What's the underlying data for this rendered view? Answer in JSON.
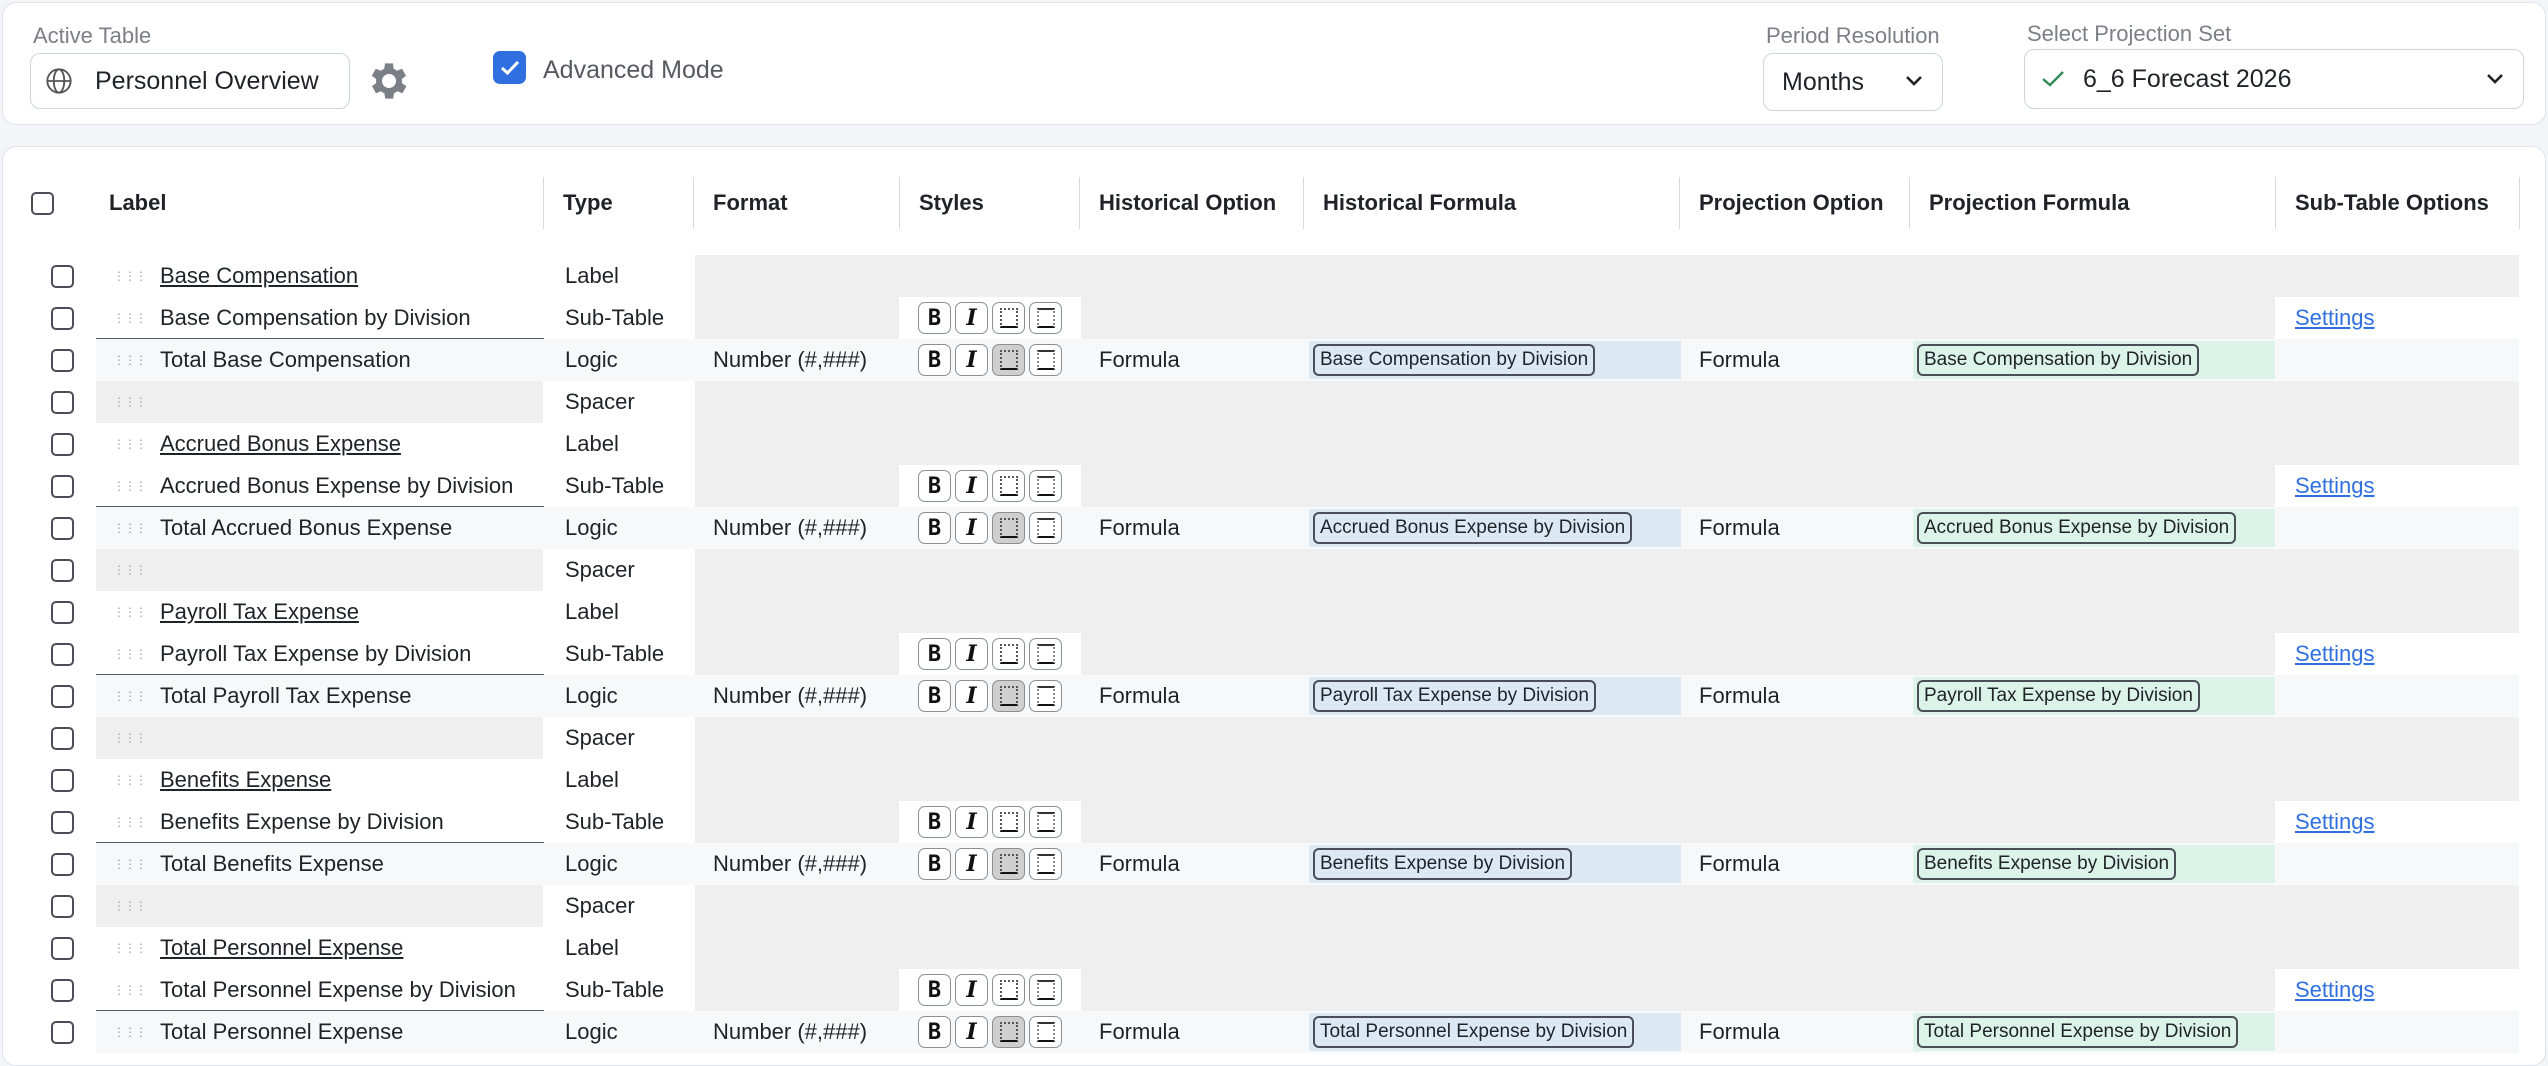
{
  "topbar": {
    "active_table_label": "Active Table",
    "active_table_value": "Personnel Overview",
    "advanced_mode_label": "Advanced Mode",
    "advanced_mode_checked": true,
    "period_label": "Period Resolution",
    "period_value": "Months",
    "projection_set_label": "Select Projection Set",
    "projection_set_value": "6_6 Forecast 2026"
  },
  "columns": {
    "label": "Label",
    "type": "Type",
    "format": "Format",
    "styles": "Styles",
    "historical_option": "Historical Option",
    "historical_formula": "Historical Formula",
    "projection_option": "Projection Option",
    "projection_formula": "Projection Formula",
    "subtable_options": "Sub-Table Options"
  },
  "colors": {
    "accent": "#2f6fe0",
    "historical_formula_bg": "#dce9f5",
    "projection_formula_bg": "#dcf3e9",
    "disabled_bg": "#efefef"
  },
  "rows": [
    {
      "label": "Base Compensation",
      "type": "Label"
    },
    {
      "label": "Base Compensation by Division",
      "type": "Sub-Table",
      "settings": "Settings"
    },
    {
      "label": "Total Base Compensation",
      "type": "Logic",
      "format": "Number (#,###)",
      "historical_option": "Formula",
      "historical_formula": "Base Compensation by Division",
      "projection_option": "Formula",
      "projection_formula": "Base Compensation by Division"
    },
    {
      "label": "",
      "type": "Spacer"
    },
    {
      "label": "Accrued Bonus Expense",
      "type": "Label"
    },
    {
      "label": "Accrued Bonus Expense by Division",
      "type": "Sub-Table",
      "settings": "Settings"
    },
    {
      "label": "Total Accrued Bonus Expense",
      "type": "Logic",
      "format": "Number (#,###)",
      "historical_option": "Formula",
      "historical_formula": "Accrued Bonus Expense by Division",
      "projection_option": "Formula",
      "projection_formula": "Accrued Bonus Expense by Division"
    },
    {
      "label": "",
      "type": "Spacer"
    },
    {
      "label": "Payroll Tax Expense",
      "type": "Label"
    },
    {
      "label": "Payroll Tax Expense by Division",
      "type": "Sub-Table",
      "settings": "Settings"
    },
    {
      "label": "Total Payroll Tax Expense",
      "type": "Logic",
      "format": "Number (#,###)",
      "historical_option": "Formula",
      "historical_formula": "Payroll Tax Expense by Division",
      "projection_option": "Formula",
      "projection_formula": "Payroll Tax Expense by Division"
    },
    {
      "label": "",
      "type": "Spacer"
    },
    {
      "label": "Benefits Expense",
      "type": "Label"
    },
    {
      "label": "Benefits Expense by Division",
      "type": "Sub-Table",
      "settings": "Settings"
    },
    {
      "label": "Total Benefits Expense",
      "type": "Logic",
      "format": "Number (#,###)",
      "historical_option": "Formula",
      "historical_formula": "Benefits Expense by Division",
      "projection_option": "Formula",
      "projection_formula": "Benefits Expense by Division"
    },
    {
      "label": "",
      "type": "Spacer"
    },
    {
      "label": "Total Personnel Expense",
      "type": "Label"
    },
    {
      "label": "Total Personnel Expense by Division",
      "type": "Sub-Table",
      "settings": "Settings"
    },
    {
      "label": "Total Personnel Expense",
      "type": "Logic",
      "format": "Number (#,###)",
      "historical_option": "Formula",
      "historical_formula": "Total Personnel Expense by Division",
      "projection_option": "Formula",
      "projection_formula": "Total Personnel Expense by Division"
    }
  ]
}
